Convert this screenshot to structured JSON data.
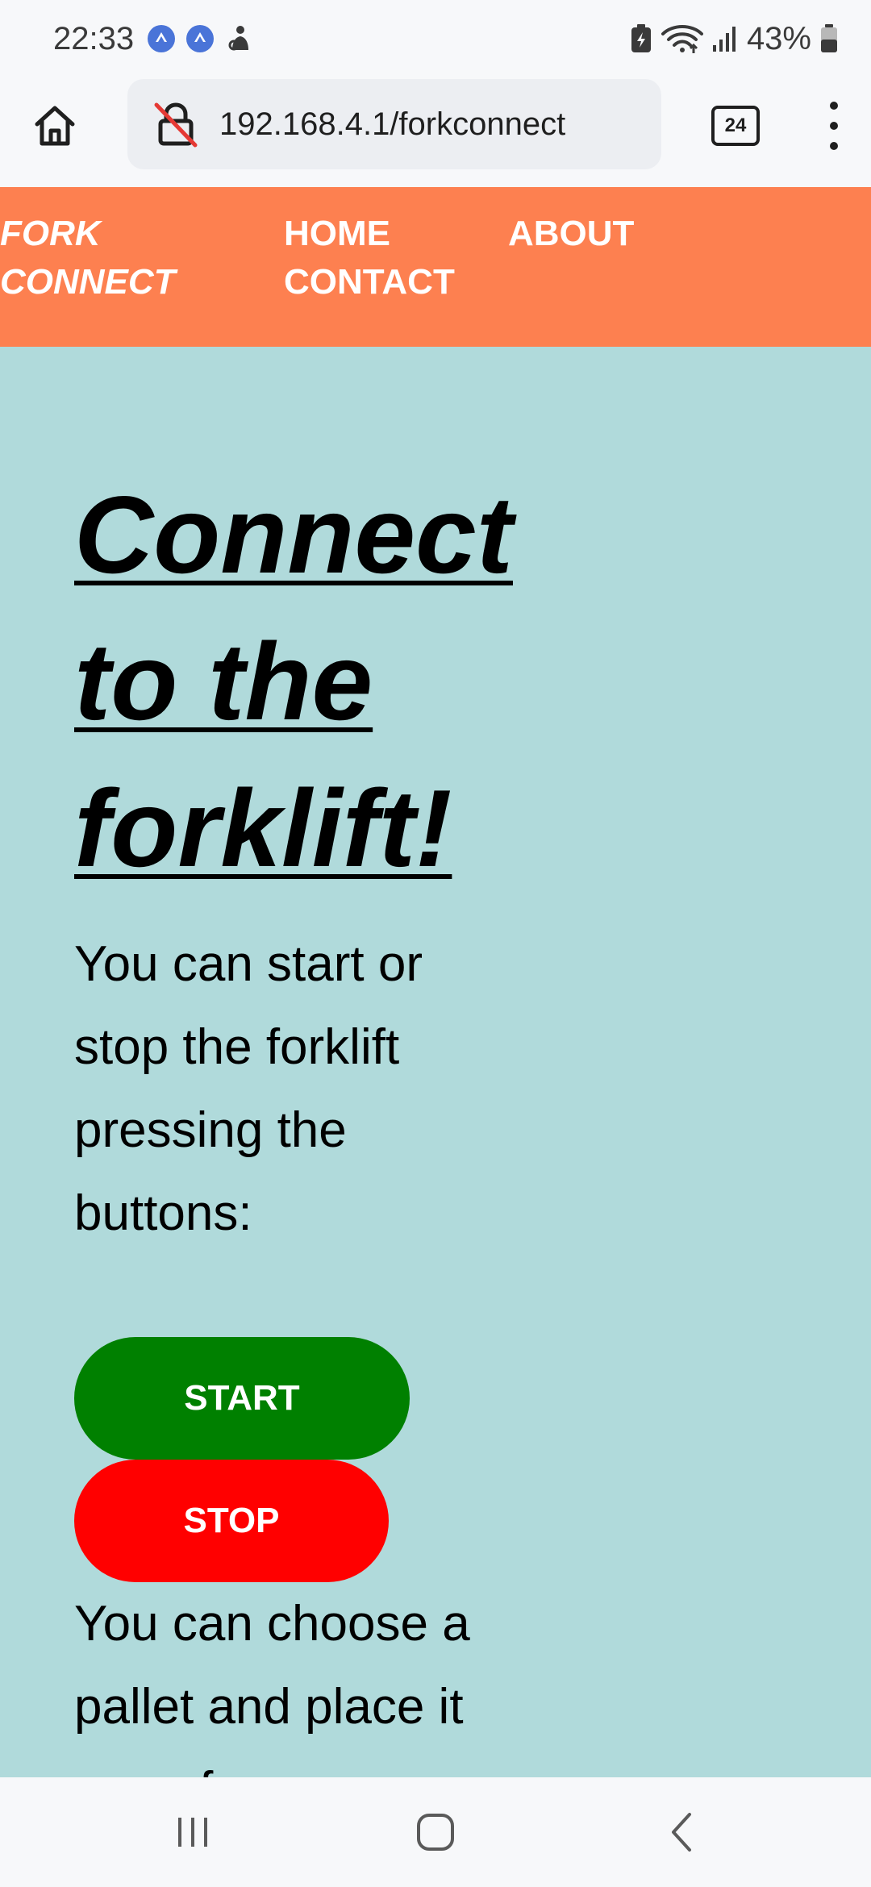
{
  "status_bar": {
    "time": "22:33",
    "battery_percent": "43%",
    "icons": [
      "app-notification-icon",
      "app-notification-icon",
      "accessibility-icon",
      "battery-saver-icon",
      "wifi-icon",
      "signal-icon",
      "battery-icon"
    ]
  },
  "browser": {
    "url": "192.168.4.1/forkconnect",
    "tab_count": "24",
    "icons": [
      "home-icon",
      "not-secure-lock-icon",
      "tabs-icon",
      "more-vert-icon"
    ]
  },
  "site_nav": {
    "brand": "FORK CONNECT",
    "links": {
      "home": "HOME",
      "about": "ABOUT",
      "contact": "CONTACT"
    },
    "color": "#fd8050"
  },
  "main": {
    "heading": "Connect to the forklift!",
    "intro": "You can start or stop the forklift pressing the buttons:",
    "start_label": "START",
    "stop_label": "STOP",
    "choose_text": "You can choose a pallet and place it one of",
    "background": "#b0dadb",
    "start_color": "#008000",
    "stop_color": "#ff0000"
  },
  "system_nav": {
    "icons": [
      "recent-apps-icon",
      "home-icon",
      "back-icon"
    ]
  }
}
